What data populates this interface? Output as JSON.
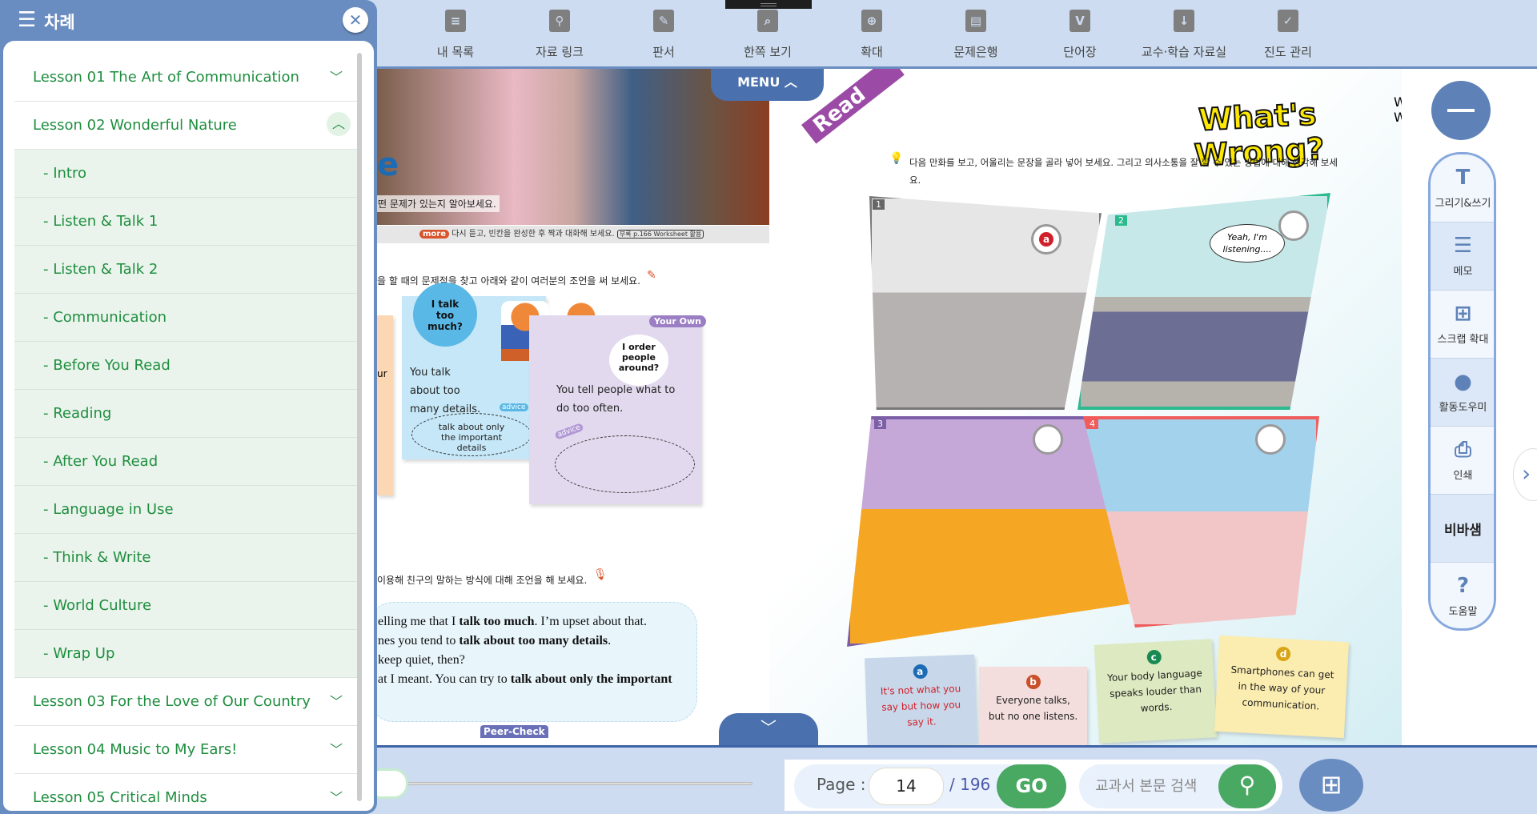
{
  "toolbar": {
    "items": [
      {
        "label": "내 목록",
        "icon": "list-icon",
        "glyph": "≡"
      },
      {
        "label": "자료 링크",
        "icon": "link-add-icon",
        "glyph": "⚲"
      },
      {
        "label": "판서",
        "icon": "pen-board-icon",
        "glyph": "✎"
      },
      {
        "label": "한쪽 보기",
        "icon": "single-page-icon",
        "glyph": "⌕"
      },
      {
        "label": "확대",
        "icon": "zoom-in-icon",
        "glyph": "⊕"
      },
      {
        "label": "문제은행",
        "icon": "question-bank-icon",
        "glyph": "▤"
      },
      {
        "label": "단어장",
        "icon": "voca-icon",
        "glyph": "V"
      },
      {
        "label": "교수·학습 자료실",
        "icon": "folder-download-icon",
        "glyph": "↓"
      },
      {
        "label": "진도 관리",
        "icon": "progress-check-icon",
        "glyph": "✓"
      }
    ]
  },
  "sidebar": {
    "title": "차례",
    "items": [
      {
        "label": "Lesson 01 The Art of Communication",
        "type": "lesson",
        "expanded": false
      },
      {
        "label": "Lesson 02 Wonderful Nature",
        "type": "lesson",
        "expanded": true
      },
      {
        "label": "- Intro",
        "type": "sub"
      },
      {
        "label": "- Listen & Talk 1",
        "type": "sub"
      },
      {
        "label": "- Listen & Talk 2",
        "type": "sub"
      },
      {
        "label": "- Communication",
        "type": "sub"
      },
      {
        "label": "- Before You Read",
        "type": "sub"
      },
      {
        "label": "- Reading",
        "type": "sub"
      },
      {
        "label": "- After You Read",
        "type": "sub"
      },
      {
        "label": "- Language in Use",
        "type": "sub"
      },
      {
        "label": "- Think & Write",
        "type": "sub"
      },
      {
        "label": "- World Culture",
        "type": "sub"
      },
      {
        "label": "- Wrap Up",
        "type": "sub"
      },
      {
        "label": "Lesson 03 For the Love of Our Country",
        "type": "lesson",
        "expanded": false
      },
      {
        "label": "Lesson 04 Music to My Ears!",
        "type": "lesson",
        "expanded": false
      },
      {
        "label": "Lesson 05 Critical Minds",
        "type": "lesson",
        "expanded": false
      }
    ]
  },
  "menu_tab": "MENU",
  "left_page": {
    "photo_caption": "어떤 문제가 있는지 알아보세요.",
    "more_badge": "more",
    "more_text": "다시 듣고, 빈칸을 완성한 후 짝과 대화해 보세요.",
    "worksheet": "부록 p.166 Worksheet 활용",
    "instruction1": "을 할 때의 문제점을 찾고 아래와 같이 여러분의 조언을 써 보세요.",
    "orange_partial": "ur",
    "blue_note": {
      "bubble": "I talk too much?",
      "text": "You talk about too many details.",
      "advice_tag": "advice",
      "advice": "talk about only the important details"
    },
    "purple_note": {
      "tag": "Your Own",
      "bubble": "I order people around?",
      "text": "You tell people what to do too often.",
      "advice_tag": "advice"
    },
    "instruction2": "이용해 친구의 말하는 방식에 대해 조언을 해 보세요.",
    "dialogue": [
      [
        {
          "t": "elling me that I "
        },
        {
          "t": "talk too much",
          "b": true
        },
        {
          "t": ". I’m upset about that."
        }
      ],
      [
        {
          "t": "nes you tend to "
        },
        {
          "t": "talk about too many details",
          "b": true
        },
        {
          "t": "."
        }
      ],
      [
        {
          "t": "keep quiet, then?"
        }
      ],
      [
        {
          "t": "at I meant. You can try to "
        },
        {
          "t": "talk about only the important",
          "b": true
        }
      ]
    ],
    "peer_check": "Peer-Check"
  },
  "right_page": {
    "ribbon": "Read",
    "title": "What's Wrong?",
    "instruction": "다음 만화를 보고, 어울리는 문장을 골라 넣어 보세요. 그리고 의사소통을 잘 할 수 있는 방법에 대해 생각해 보세요.",
    "panels": [
      {
        "num": "1",
        "answer": "a"
      },
      {
        "num": "2",
        "answer": "",
        "speech": "Yeah, I'm listening...."
      },
      {
        "num": "3",
        "answer": ""
      },
      {
        "num": "4",
        "answer": ""
      }
    ],
    "notes": [
      {
        "letter": "a",
        "text": "It's not what you say but how you say it.",
        "color": "#c8d8ea",
        "letter_color": "#1c6bb5"
      },
      {
        "letter": "b",
        "text": "Everyone talks, but no one listens.",
        "color": "#f3dedd",
        "letter_color": "#c9502a"
      },
      {
        "letter": "c",
        "text": "Your body language speaks louder than words.",
        "color": "#dde9c0",
        "letter_color": "#1a8a54"
      },
      {
        "letter": "d",
        "text": "Smartphones can get in the way of your communication.",
        "color": "#fbecb0",
        "letter_color": "#d9a515"
      }
    ]
  },
  "tools": [
    {
      "label": "그리기&쓰기",
      "icon": "draw-write-icon",
      "glyph": "T"
    },
    {
      "label": "메모",
      "icon": "memo-icon",
      "glyph": "☰"
    },
    {
      "label": "스크랩 확대",
      "icon": "scrap-zoom-icon",
      "glyph": "⊞"
    },
    {
      "label": "활동도우미",
      "icon": "activity-helper-icon",
      "glyph": "●"
    },
    {
      "label": "인쇄",
      "icon": "print-icon",
      "glyph": "⎙"
    },
    {
      "label": "비바샘",
      "icon": "vivasam-logo",
      "glyph": ""
    },
    {
      "label": "도움말",
      "icon": "help-icon",
      "glyph": "?"
    }
  ],
  "bottom": {
    "page_label": "Page :",
    "page_value": "14",
    "total": "/ 196",
    "go": "GO",
    "search_placeholder": "교과서 본문 검색"
  },
  "colors": {
    "accent": "#6a8dc1",
    "green": "#1f8e3f",
    "go": "#49a862"
  }
}
